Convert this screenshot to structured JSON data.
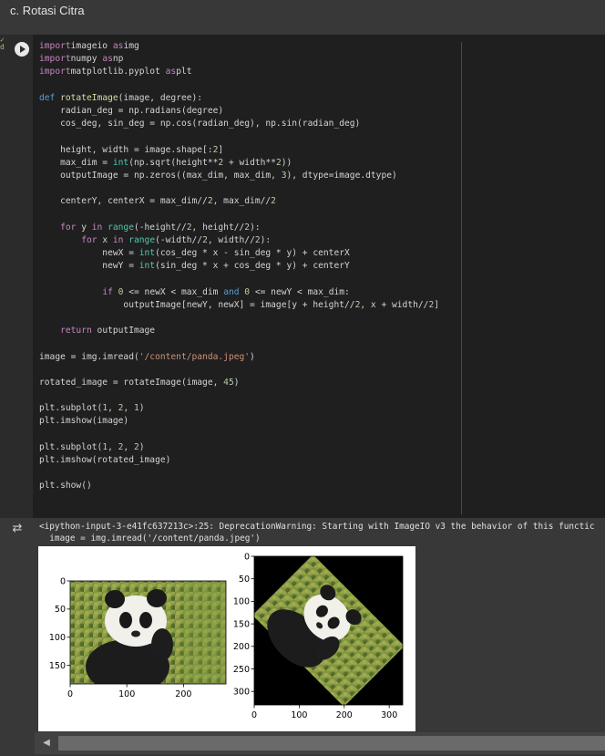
{
  "section_title": "c. Rotasi Citra",
  "code_lines": [
    [
      [
        "kw2",
        "import"
      ],
      [
        "",
        "imageio "
      ],
      [
        "kw2",
        "as"
      ],
      [
        "",
        "img"
      ]
    ],
    [
      [
        "kw2",
        "import"
      ],
      [
        "",
        "numpy "
      ],
      [
        "kw2",
        "as"
      ],
      [
        "",
        "np"
      ]
    ],
    [
      [
        "kw2",
        "import"
      ],
      [
        "",
        "matplotlib.pyplot "
      ],
      [
        "kw2",
        "as"
      ],
      [
        "",
        "plt"
      ]
    ],
    [],
    [
      [
        "kw",
        "def "
      ],
      [
        "fn",
        "rotateImage"
      ],
      [
        "",
        "(image, degree):"
      ]
    ],
    [
      [
        "",
        "    radian_deg = np.radians(degree)"
      ]
    ],
    [
      [
        "",
        "    cos_deg, sin_deg = np.cos(radian_deg), np.sin(radian_deg)"
      ]
    ],
    [],
    [
      [
        "",
        "    height, width = image.shape[:"
      ],
      [
        "num",
        "2"
      ],
      [
        "",
        "]"
      ]
    ],
    [
      [
        "",
        "    max_dim = "
      ],
      [
        "bi",
        "int"
      ],
      [
        "",
        "(np.sqrt(height**"
      ],
      [
        "num",
        "2"
      ],
      [
        "",
        " + width**"
      ],
      [
        "num",
        "2"
      ],
      [
        "",
        "))"
      ]
    ],
    [
      [
        "",
        "    outputImage = np.zeros((max_dim, max_dim, "
      ],
      [
        "num",
        "3"
      ],
      [
        "",
        "), dtype=image.dtype)"
      ]
    ],
    [],
    [
      [
        "",
        "    centerY, centerX = max_dim//"
      ],
      [
        "num",
        "2"
      ],
      [
        "",
        ", max_dim//"
      ],
      [
        "num",
        "2"
      ]
    ],
    [],
    [
      [
        "",
        "    "
      ],
      [
        "kw2",
        "for"
      ],
      [
        "",
        " y "
      ],
      [
        "kw2",
        "in"
      ],
      [
        "",
        ""
      ],
      [
        "bi",
        " range"
      ],
      [
        "",
        "(-height//"
      ],
      [
        "num",
        "2"
      ],
      [
        "",
        ", height//"
      ],
      [
        "num",
        "2"
      ],
      [
        "",
        "):"
      ]
    ],
    [
      [
        "",
        "        "
      ],
      [
        "kw2",
        "for"
      ],
      [
        "",
        " x "
      ],
      [
        "kw2",
        "in"
      ],
      [
        "bi",
        " range"
      ],
      [
        "",
        "(-width//"
      ],
      [
        "num",
        "2"
      ],
      [
        "",
        ", width//"
      ],
      [
        "num",
        "2"
      ],
      [
        "",
        "):"
      ]
    ],
    [
      [
        "",
        "            newX = "
      ],
      [
        "bi",
        "int"
      ],
      [
        "",
        "(cos_deg * x - sin_deg * y) + centerX"
      ]
    ],
    [
      [
        "",
        "            newY = "
      ],
      [
        "bi",
        "int"
      ],
      [
        "",
        "(sin_deg * x + cos_deg * y) + centerY"
      ]
    ],
    [],
    [
      [
        "",
        "            "
      ],
      [
        "kw2",
        "if"
      ],
      [
        "",
        " "
      ],
      [
        "num",
        "0"
      ],
      [
        "",
        " <= newX < max_dim "
      ],
      [
        "kw",
        "and"
      ],
      [
        "",
        " "
      ],
      [
        "num",
        "0"
      ],
      [
        "",
        " <= newY < max_dim:"
      ]
    ],
    [
      [
        "",
        "                outputImage[newY, newX] = image[y + height//"
      ],
      [
        "num",
        "2"
      ],
      [
        "",
        ", x + width//"
      ],
      [
        "num",
        "2"
      ],
      [
        "",
        "]"
      ]
    ],
    [],
    [
      [
        "",
        "    "
      ],
      [
        "kw2",
        "return"
      ],
      [
        "",
        " outputImage"
      ]
    ],
    [],
    [
      [
        "",
        "image = img.imread("
      ],
      [
        "str",
        "'/content/panda.jpeg'"
      ],
      [
        "",
        ")"
      ]
    ],
    [],
    [
      [
        "",
        "rotated_image = rotateImage(image, "
      ],
      [
        "num",
        "45"
      ],
      [
        "",
        ")"
      ]
    ],
    [],
    [
      [
        "",
        "plt.subplot("
      ],
      [
        "num",
        "1"
      ],
      [
        "",
        ", "
      ],
      [
        "num",
        "2"
      ],
      [
        "",
        ", "
      ],
      [
        "num",
        "1"
      ],
      [
        "",
        ")"
      ]
    ],
    [
      [
        "",
        "plt.imshow(image)"
      ]
    ],
    [],
    [
      [
        "",
        "plt.subplot("
      ],
      [
        "num",
        "1"
      ],
      [
        "",
        ", "
      ],
      [
        "num",
        "2"
      ],
      [
        "",
        ", "
      ],
      [
        "num",
        "2"
      ],
      [
        "",
        ")"
      ]
    ],
    [
      [
        "",
        "plt.imshow(rotated_image)"
      ]
    ],
    [],
    [
      [
        "",
        "plt.show()"
      ]
    ]
  ],
  "output": {
    "warning_line1": "<ipython-input-3-e41fc637213c>:25: DeprecationWarning: Starting with ImageIO v3 the behavior of this functic",
    "warning_line2": "  image = img.imread('/content/panda.jpeg')"
  },
  "chart_data": [
    {
      "type": "image",
      "xlim": [
        0,
        275
      ],
      "ylim": [
        183,
        0
      ],
      "xticks": [
        0,
        100,
        200
      ],
      "yticks": [
        0,
        50,
        100,
        150
      ]
    },
    {
      "type": "image",
      "xlim": [
        0,
        330
      ],
      "ylim": [
        330,
        0
      ],
      "xticks": [
        0,
        100,
        200,
        300
      ],
      "yticks": [
        0,
        50,
        100,
        150,
        200,
        250,
        300
      ]
    }
  ],
  "icons": {
    "run": "play-circle-icon",
    "output_toggle": "output-collapse-icon",
    "scroll_left": "arrow-left-icon"
  },
  "colors": {
    "keyword": "#569cd6",
    "control": "#c586c0",
    "function": "#dcdcaa",
    "string": "#ce9178",
    "number": "#b5cea8"
  }
}
